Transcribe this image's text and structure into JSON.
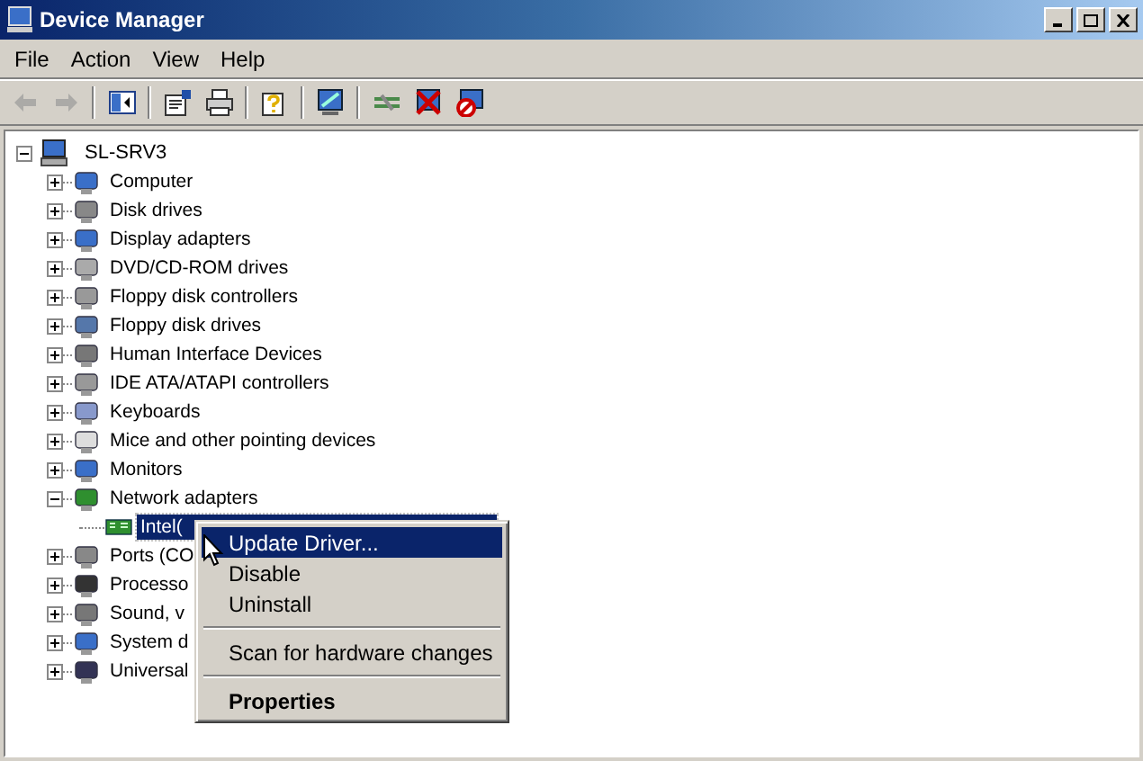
{
  "window": {
    "title": "Device Manager"
  },
  "menu": [
    {
      "label": "File"
    },
    {
      "label": "Action"
    },
    {
      "label": "View"
    },
    {
      "label": "Help"
    }
  ],
  "toolbar": [
    [
      {
        "disabled": true
      },
      {
        "disabled": true
      }
    ],
    [
      {
        "disabled": false
      }
    ],
    [
      {
        "disabled": false
      },
      {
        "disabled": false
      }
    ],
    [
      {
        "disabled": false
      }
    ],
    [
      {
        "disabled": false
      }
    ],
    [
      {
        "disabled": false
      },
      {
        "disabled": false
      },
      {
        "disabled": false
      }
    ]
  ],
  "tree": {
    "label": "SL-SRV3",
    "expanded": true,
    "selected": false,
    "children": [
      {
        "label": "Computer",
        "expanded": false,
        "selected": false
      },
      {
        "label": "Disk drives",
        "expanded": false,
        "selected": false
      },
      {
        "label": "Display adapters",
        "expanded": false,
        "selected": false
      },
      {
        "label": "DVD/CD-ROM drives",
        "expanded": false,
        "selected": false
      },
      {
        "label": "Floppy disk controllers",
        "expanded": false,
        "selected": false
      },
      {
        "label": "Floppy disk drives",
        "expanded": false,
        "selected": false
      },
      {
        "label": "Human Interface Devices",
        "expanded": false,
        "selected": false
      },
      {
        "label": "IDE ATA/ATAPI controllers",
        "expanded": false,
        "selected": false
      },
      {
        "label": "Keyboards",
        "expanded": false,
        "selected": false
      },
      {
        "label": "Mice and other pointing devices",
        "expanded": false,
        "selected": false
      },
      {
        "label": "Monitors",
        "expanded": false,
        "selected": false
      },
      {
        "label": "Network adapters",
        "expanded": true,
        "selected": false,
        "children": [
          {
            "label": "Intel(",
            "selected": true
          }
        ]
      },
      {
        "label": "Ports (CO",
        "expanded": false,
        "selected": false
      },
      {
        "label": "Processo",
        "expanded": false,
        "selected": false
      },
      {
        "label": "Sound, v",
        "expanded": false,
        "selected": false
      },
      {
        "label": "System d",
        "expanded": false,
        "selected": false
      },
      {
        "label": "Universal",
        "expanded": false,
        "selected": false
      }
    ]
  },
  "context_menu": [
    {
      "kind": "item",
      "label": "Update Driver...",
      "selected": true,
      "bold": false
    },
    {
      "kind": "item",
      "label": "Disable",
      "selected": false,
      "bold": false
    },
    {
      "kind": "item",
      "label": "Uninstall",
      "selected": false,
      "bold": false
    },
    {
      "kind": "separator"
    },
    {
      "kind": "item",
      "label": "Scan for hardware changes",
      "selected": false,
      "bold": false
    },
    {
      "kind": "separator"
    },
    {
      "kind": "item",
      "label": "Properties",
      "selected": false,
      "bold": true
    }
  ]
}
